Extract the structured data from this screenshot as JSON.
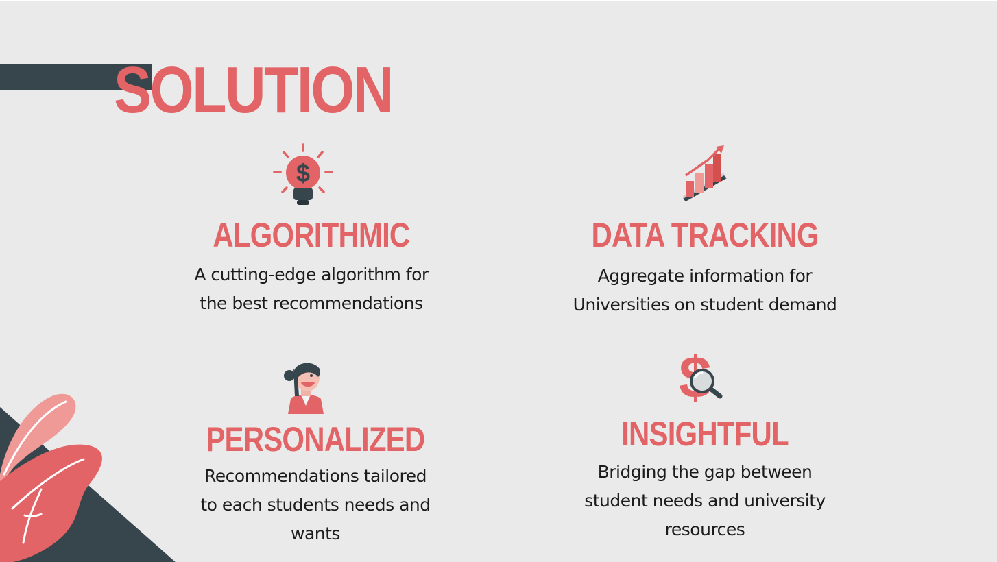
{
  "slide": {
    "title": "SOLUTION",
    "colors": {
      "accent": "#e26466",
      "accent_light": "#f29a99",
      "dark": "#37454d",
      "background": "#eaeaea",
      "text": "#1c1c1c"
    },
    "features": [
      {
        "icon": "lightbulb-dollar-icon",
        "heading": "ALGORITHMIC",
        "description": [
          "A cutting-edge algorithm for",
          "the best recommendations"
        ]
      },
      {
        "icon": "bar-chart-growth-icon",
        "heading": "DATA TRACKING",
        "description": [
          "Aggregate information  for",
          "Universities on student demand"
        ]
      },
      {
        "icon": "student-avatar-icon",
        "heading": "PERSONALIZED",
        "description": [
          "Recommendations tailored",
          "to each students needs and",
          "wants"
        ]
      },
      {
        "icon": "dollar-magnifier-icon",
        "heading": "INSIGHTFUL",
        "description": [
          "Bridging the gap between",
          "student needs and university",
          "resources"
        ]
      }
    ]
  }
}
